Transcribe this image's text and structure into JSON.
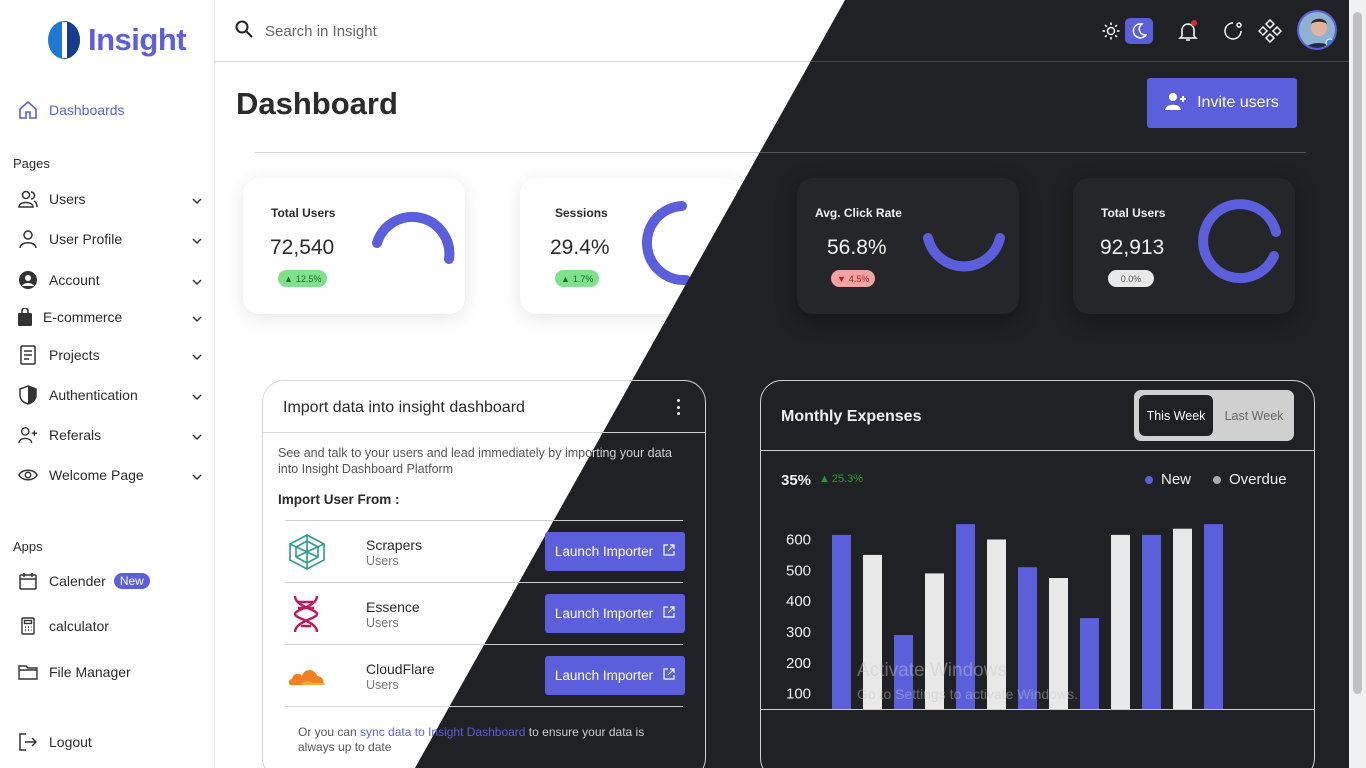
{
  "app": {
    "name": "Insight"
  },
  "search": {
    "placeholder": "Search in Insight"
  },
  "sidebar": {
    "dashboards": "Dashboards",
    "pages_label": "Pages",
    "pages": [
      {
        "label": "Users",
        "icon": "users-icon"
      },
      {
        "label": "User Profile",
        "icon": "user-icon"
      },
      {
        "label": "Account",
        "icon": "account-circle-icon"
      },
      {
        "label": "E-commerce",
        "icon": "bag-icon"
      },
      {
        "label": "Projects",
        "icon": "document-icon"
      },
      {
        "label": "Authentication",
        "icon": "shield-icon"
      },
      {
        "label": "Referals",
        "icon": "user-plus-icon"
      },
      {
        "label": "Welcome Page",
        "icon": "eye-icon"
      }
    ],
    "apps_label": "Apps",
    "apps": [
      {
        "label": "Calender",
        "badge": "New",
        "icon": "calendar-icon"
      },
      {
        "label": "calculator",
        "icon": "calculator-icon"
      },
      {
        "label": "File Manager",
        "icon": "folder-icon"
      }
    ],
    "logout": "Logout"
  },
  "header": {
    "title": "Dashboard",
    "invite_label": "Invite users",
    "notification_dot_color": "#e0282e"
  },
  "stats": [
    {
      "label": "Total Users",
      "value": "72,540",
      "change": "12.5%",
      "trend": "up",
      "arc_fraction": 0.45
    },
    {
      "label": "Sessions",
      "value": "29.4%",
      "change": "1.7%",
      "trend": "up",
      "arc_fraction": 0.35
    },
    {
      "label": "Avg. Click Rate",
      "value": "56.8%",
      "change": "4.5%",
      "trend": "down",
      "arc_fraction": 0.6
    },
    {
      "label": "Total Users",
      "value": "92,913",
      "change": "0.0%",
      "trend": "flat",
      "arc_fraction": 0.8
    }
  ],
  "import_card": {
    "title": "Import data into insight dashboard",
    "description": "See and talk to your users and lead immediately by importing your data into Insight Dashboard Platform",
    "import_from": "Import User From :",
    "rows": [
      {
        "name": "Scrapers",
        "sub": "Users",
        "button": "Launch Importer"
      },
      {
        "name": "Essence",
        "sub": "Users",
        "button": "Launch Importer"
      },
      {
        "name": "CloudFlare",
        "sub": "Users",
        "button": "Launch Importer"
      }
    ],
    "note_prefix": "Or you can ",
    "note_link": "sync data to Insight Dashboard",
    "note_suffix": " to ensure your data is always up to date"
  },
  "expenses": {
    "title": "Monthly Expenses",
    "this_week": "This Week",
    "last_week": "Last Week",
    "percent": "35%",
    "change": "25.3%",
    "legend_new": "New",
    "legend_overdue": "Overdue",
    "colors": {
      "new": "#5b5fdc",
      "overdue": "#e8e8e8"
    }
  },
  "chart_data": {
    "type": "bar",
    "title": "Monthly Expenses",
    "y_ticks": [
      100,
      200,
      300,
      400,
      500,
      600
    ],
    "ylim": [
      50,
      660
    ],
    "series_colors": [
      "#5b5fdc",
      "#e8e8e8"
    ],
    "bars": [
      {
        "value": 615,
        "series": "New"
      },
      {
        "value": 550,
        "series": "Overdue"
      },
      {
        "value": 290,
        "series": "New"
      },
      {
        "value": 490,
        "series": "Overdue"
      },
      {
        "value": 650,
        "series": "New"
      },
      {
        "value": 600,
        "series": "Overdue"
      },
      {
        "value": 510,
        "series": "New"
      },
      {
        "value": 475,
        "series": "Overdue"
      },
      {
        "value": 345,
        "series": "New"
      },
      {
        "value": 615,
        "series": "Overdue"
      },
      {
        "value": 615,
        "series": "New"
      },
      {
        "value": 635,
        "series": "Overdue"
      },
      {
        "value": 650,
        "series": "New"
      }
    ]
  },
  "watermark": {
    "line1": "Activate Windows",
    "line2": "Go to Settings to activate Windows."
  }
}
